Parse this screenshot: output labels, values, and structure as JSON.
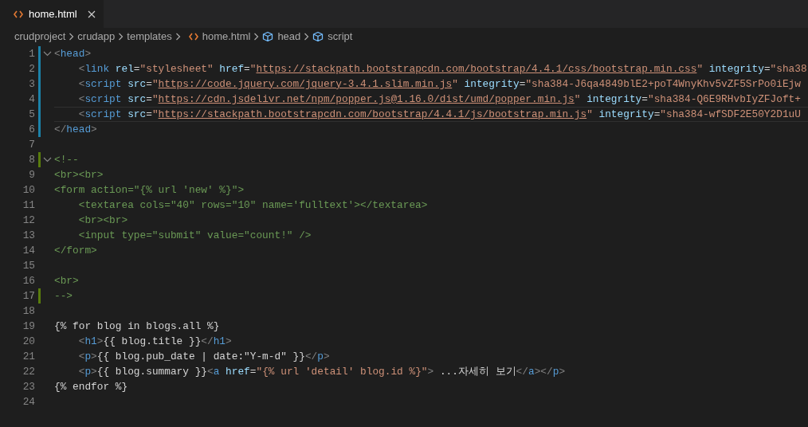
{
  "tabs": [
    {
      "label": "home.html",
      "selected": true
    }
  ],
  "breadcrumbs": [
    {
      "kind": "folder",
      "label": "crudproject"
    },
    {
      "kind": "folder",
      "label": "crudapp"
    },
    {
      "kind": "folder",
      "label": "templates"
    },
    {
      "kind": "file",
      "label": "home.html"
    },
    {
      "kind": "element",
      "label": "head"
    },
    {
      "kind": "element",
      "label": "script"
    }
  ],
  "lines": [
    {
      "number": "1",
      "modified": true,
      "added": false,
      "foldable": true,
      "current": false,
      "tokens": [
        {
          "kind": "punct",
          "text": "<"
        },
        {
          "kind": "tag",
          "text": "head"
        },
        {
          "kind": "punct",
          "text": ">"
        }
      ]
    },
    {
      "number": "2",
      "modified": true,
      "added": false,
      "foldable": false,
      "current": false,
      "tokens": [
        {
          "kind": "punct",
          "text": "    <"
        },
        {
          "kind": "tag",
          "text": "link"
        },
        {
          "kind": "attr",
          "text": " rel"
        },
        {
          "kind": "plain",
          "text": "="
        },
        {
          "kind": "string",
          "text": "\"stylesheet\""
        },
        {
          "kind": "attr",
          "text": " href"
        },
        {
          "kind": "plain",
          "text": "="
        },
        {
          "kind": "string",
          "text": "\""
        },
        {
          "kind": "url",
          "text": "https://stackpath.bootstrapcdn.com/bootstrap/4.4.1/css/bootstrap.min.css"
        },
        {
          "kind": "string",
          "text": "\""
        },
        {
          "kind": "attr",
          "text": " integrity"
        },
        {
          "kind": "plain",
          "text": "="
        },
        {
          "kind": "string",
          "text": "\"sha38"
        }
      ]
    },
    {
      "number": "3",
      "modified": true,
      "added": false,
      "foldable": false,
      "current": false,
      "tokens": [
        {
          "kind": "punct",
          "text": "    <"
        },
        {
          "kind": "tag",
          "text": "script"
        },
        {
          "kind": "attr",
          "text": " src"
        },
        {
          "kind": "plain",
          "text": "="
        },
        {
          "kind": "string",
          "text": "\""
        },
        {
          "kind": "url",
          "text": "https://code.jquery.com/jquery-3.4.1.slim.min.js"
        },
        {
          "kind": "string",
          "text": "\""
        },
        {
          "kind": "attr",
          "text": " integrity"
        },
        {
          "kind": "plain",
          "text": "="
        },
        {
          "kind": "string",
          "text": "\"sha384-J6qa4849blE2+poT4WnyKhv5vZF5SrPo0iEjw"
        }
      ]
    },
    {
      "number": "4",
      "modified": true,
      "added": false,
      "foldable": false,
      "current": false,
      "tokens": [
        {
          "kind": "punct",
          "text": "    <"
        },
        {
          "kind": "tag",
          "text": "script"
        },
        {
          "kind": "attr",
          "text": " src"
        },
        {
          "kind": "plain",
          "text": "="
        },
        {
          "kind": "string",
          "text": "\""
        },
        {
          "kind": "url",
          "text": "https://cdn.jsdelivr.net/npm/popper.js@1.16.0/dist/umd/popper.min.js"
        },
        {
          "kind": "string",
          "text": "\""
        },
        {
          "kind": "attr",
          "text": " integrity"
        },
        {
          "kind": "plain",
          "text": "="
        },
        {
          "kind": "string",
          "text": "\"sha384-Q6E9RHvbIyZFJoft+"
        }
      ]
    },
    {
      "number": "5",
      "modified": true,
      "added": false,
      "foldable": false,
      "current": true,
      "tokens": [
        {
          "kind": "punct",
          "text": "    <"
        },
        {
          "kind": "tag",
          "text": "script"
        },
        {
          "kind": "attr",
          "text": " src"
        },
        {
          "kind": "plain",
          "text": "="
        },
        {
          "kind": "string",
          "text": "\""
        },
        {
          "kind": "url",
          "text": "https://stackpath.bootstrapcdn.com/bootstrap/4.4.1/js/bootstrap.min.js"
        },
        {
          "kind": "string",
          "text": "\""
        },
        {
          "kind": "attr",
          "text": " integrity"
        },
        {
          "kind": "plain",
          "text": "="
        },
        {
          "kind": "string",
          "text": "\"sha384-wfSDF2E50Y2D1uU"
        }
      ]
    },
    {
      "number": "6",
      "modified": true,
      "added": false,
      "foldable": false,
      "current": false,
      "tokens": [
        {
          "kind": "punct",
          "text": "</"
        },
        {
          "kind": "tag",
          "text": "head"
        },
        {
          "kind": "punct",
          "text": ">"
        }
      ]
    },
    {
      "number": "7",
      "modified": false,
      "added": false,
      "foldable": false,
      "current": false
    },
    {
      "number": "8",
      "modified": false,
      "added": true,
      "foldable": true,
      "current": false,
      "tokens": [
        {
          "kind": "comment",
          "text": "<!--"
        }
      ]
    },
    {
      "number": "9",
      "modified": false,
      "added": false,
      "foldable": false,
      "current": false,
      "tokens": [
        {
          "kind": "comment",
          "text": "<br><br>"
        }
      ]
    },
    {
      "number": "10",
      "modified": false,
      "added": false,
      "foldable": false,
      "current": false,
      "tokens": [
        {
          "kind": "comment",
          "text": "<form action=\"{% url 'new' %}\">"
        }
      ]
    },
    {
      "number": "11",
      "modified": false,
      "added": false,
      "foldable": false,
      "current": false,
      "tokens": [
        {
          "kind": "comment",
          "text": "    <textarea cols=\"40\" rows=\"10\" name='fulltext'></textarea>"
        }
      ]
    },
    {
      "number": "12",
      "modified": false,
      "added": false,
      "foldable": false,
      "current": false,
      "tokens": [
        {
          "kind": "comment",
          "text": "    <br><br>"
        }
      ]
    },
    {
      "number": "13",
      "modified": false,
      "added": false,
      "foldable": false,
      "current": false,
      "tokens": [
        {
          "kind": "comment",
          "text": "    <input type=\"submit\" value=\"count!\" />"
        }
      ]
    },
    {
      "number": "14",
      "modified": false,
      "added": false,
      "foldable": false,
      "current": false,
      "tokens": [
        {
          "kind": "comment",
          "text": "</form>"
        }
      ]
    },
    {
      "number": "15",
      "modified": false,
      "added": false,
      "foldable": false,
      "current": false
    },
    {
      "number": "16",
      "modified": false,
      "added": false,
      "foldable": false,
      "current": false,
      "tokens": [
        {
          "kind": "comment",
          "text": "<br>"
        }
      ]
    },
    {
      "number": "17",
      "modified": false,
      "added": true,
      "foldable": false,
      "current": false,
      "tokens": [
        {
          "kind": "comment",
          "text": "-->"
        }
      ]
    },
    {
      "number": "18",
      "modified": false,
      "added": false,
      "foldable": false,
      "current": false
    },
    {
      "number": "19",
      "modified": false,
      "added": false,
      "foldable": false,
      "current": false,
      "tokens": [
        {
          "kind": "plain",
          "text": "{% for blog in blogs.all %}"
        }
      ]
    },
    {
      "number": "20",
      "modified": false,
      "added": false,
      "foldable": false,
      "current": false,
      "tokens": [
        {
          "kind": "punct",
          "text": "    <"
        },
        {
          "kind": "tag",
          "text": "h1"
        },
        {
          "kind": "punct",
          "text": ">"
        },
        {
          "kind": "plain",
          "text": "{{ blog.title }}"
        },
        {
          "kind": "punct",
          "text": "</"
        },
        {
          "kind": "tag",
          "text": "h1"
        },
        {
          "kind": "punct",
          "text": ">"
        }
      ]
    },
    {
      "number": "21",
      "modified": false,
      "added": false,
      "foldable": false,
      "current": false,
      "tokens": [
        {
          "kind": "punct",
          "text": "    <"
        },
        {
          "kind": "tag",
          "text": "p"
        },
        {
          "kind": "punct",
          "text": ">"
        },
        {
          "kind": "plain",
          "text": "{{ blog.pub_date | date:\"Y-m-d\" }}"
        },
        {
          "kind": "punct",
          "text": "</"
        },
        {
          "kind": "tag",
          "text": "p"
        },
        {
          "kind": "punct",
          "text": ">"
        }
      ]
    },
    {
      "number": "22",
      "modified": false,
      "added": false,
      "foldable": false,
      "current": false,
      "tokens": [
        {
          "kind": "punct",
          "text": "    <"
        },
        {
          "kind": "tag",
          "text": "p"
        },
        {
          "kind": "punct",
          "text": ">"
        },
        {
          "kind": "plain",
          "text": "{{ blog.summary }}"
        },
        {
          "kind": "punct",
          "text": "<"
        },
        {
          "kind": "tag",
          "text": "a"
        },
        {
          "kind": "attr",
          "text": " href"
        },
        {
          "kind": "plain",
          "text": "="
        },
        {
          "kind": "string",
          "text": "\"{% url 'detail' blog.id %}\""
        },
        {
          "kind": "punct",
          "text": ">"
        },
        {
          "kind": "plain",
          "text": " ...자세히 보기"
        },
        {
          "kind": "punct",
          "text": "</"
        },
        {
          "kind": "tag",
          "text": "a"
        },
        {
          "kind": "punct",
          "text": "></"
        },
        {
          "kind": "tag",
          "text": "p"
        },
        {
          "kind": "punct",
          "text": ">"
        }
      ]
    },
    {
      "number": "23",
      "modified": false,
      "added": false,
      "foldable": false,
      "current": false,
      "tokens": [
        {
          "kind": "plain",
          "text": "{% endfor %}"
        }
      ]
    },
    {
      "number": "24",
      "modified": false,
      "added": false,
      "foldable": false,
      "current": false
    }
  ]
}
